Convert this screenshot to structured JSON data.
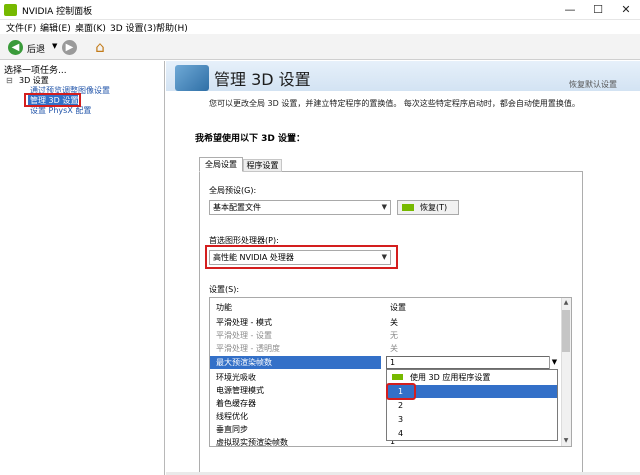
{
  "window": {
    "title": "NVIDIA 控制面板",
    "controls": {
      "minimize": "—",
      "maximize": "☐",
      "close": "✕"
    }
  },
  "menu": [
    "文件(F)",
    "编辑(E)",
    "桌面(K)",
    "3D 设置(3)",
    "帮助(H)"
  ],
  "toolbar": {
    "back_label": "后退",
    "back_icon": "arrow-left-icon",
    "forward_icon": "arrow-right-icon",
    "home_icon": "home-icon"
  },
  "left_panel": {
    "task_label": "选择一项任务...",
    "tree_root": "3D 设置",
    "tree_expander": "⊟",
    "tree_items": [
      "通过预览调整图像设置",
      "管理 3D 设置",
      "设置 PhysX 配置"
    ]
  },
  "main": {
    "title": "管理 3D 设置",
    "restore_defaults": "恢复默认设置",
    "description": "您可以更改全局 3D 设置，并建立特定程序的置换值。 每次这些特定程序启动时，都会自动使用置换值。",
    "section_title": "我希望使用以下 3D 设置：",
    "tabs": [
      "全局设置",
      "程序设置"
    ],
    "preset_label": "全局预设(G):",
    "preset_value": "基本配置文件",
    "restore_button": "恢复(T)",
    "gpu_label": "首选图形处理器(P):",
    "gpu_value": "高性能 NVIDIA 处理器",
    "settings_label": "设置(S):",
    "table": {
      "headers": [
        "功能",
        "设置"
      ],
      "rows": [
        {
          "feature": "平滑处理 - 模式",
          "value": "关"
        },
        {
          "feature": "平滑处理 - 设置",
          "value": "无"
        },
        {
          "feature": "平滑处理 - 透明度",
          "value": "关"
        },
        {
          "feature": "最大预渲染帧数",
          "value": "1"
        },
        {
          "feature": "环境光吸收",
          "value": ""
        },
        {
          "feature": "电源管理模式",
          "value": ""
        },
        {
          "feature": "着色缓存器",
          "value": ""
        },
        {
          "feature": "线程优化",
          "value": ""
        },
        {
          "feature": "垂直同步",
          "value": ""
        },
        {
          "feature": "虚拟现实预渲染帧数",
          "value": "1"
        }
      ]
    },
    "dropdown_options": [
      "使用 3D 应用程序设置",
      "1",
      "2",
      "3",
      "4"
    ]
  },
  "colors": {
    "nvidia_green": "#76b900",
    "selection_blue": "#3370c8",
    "highlight_red": "#d41e1e"
  }
}
